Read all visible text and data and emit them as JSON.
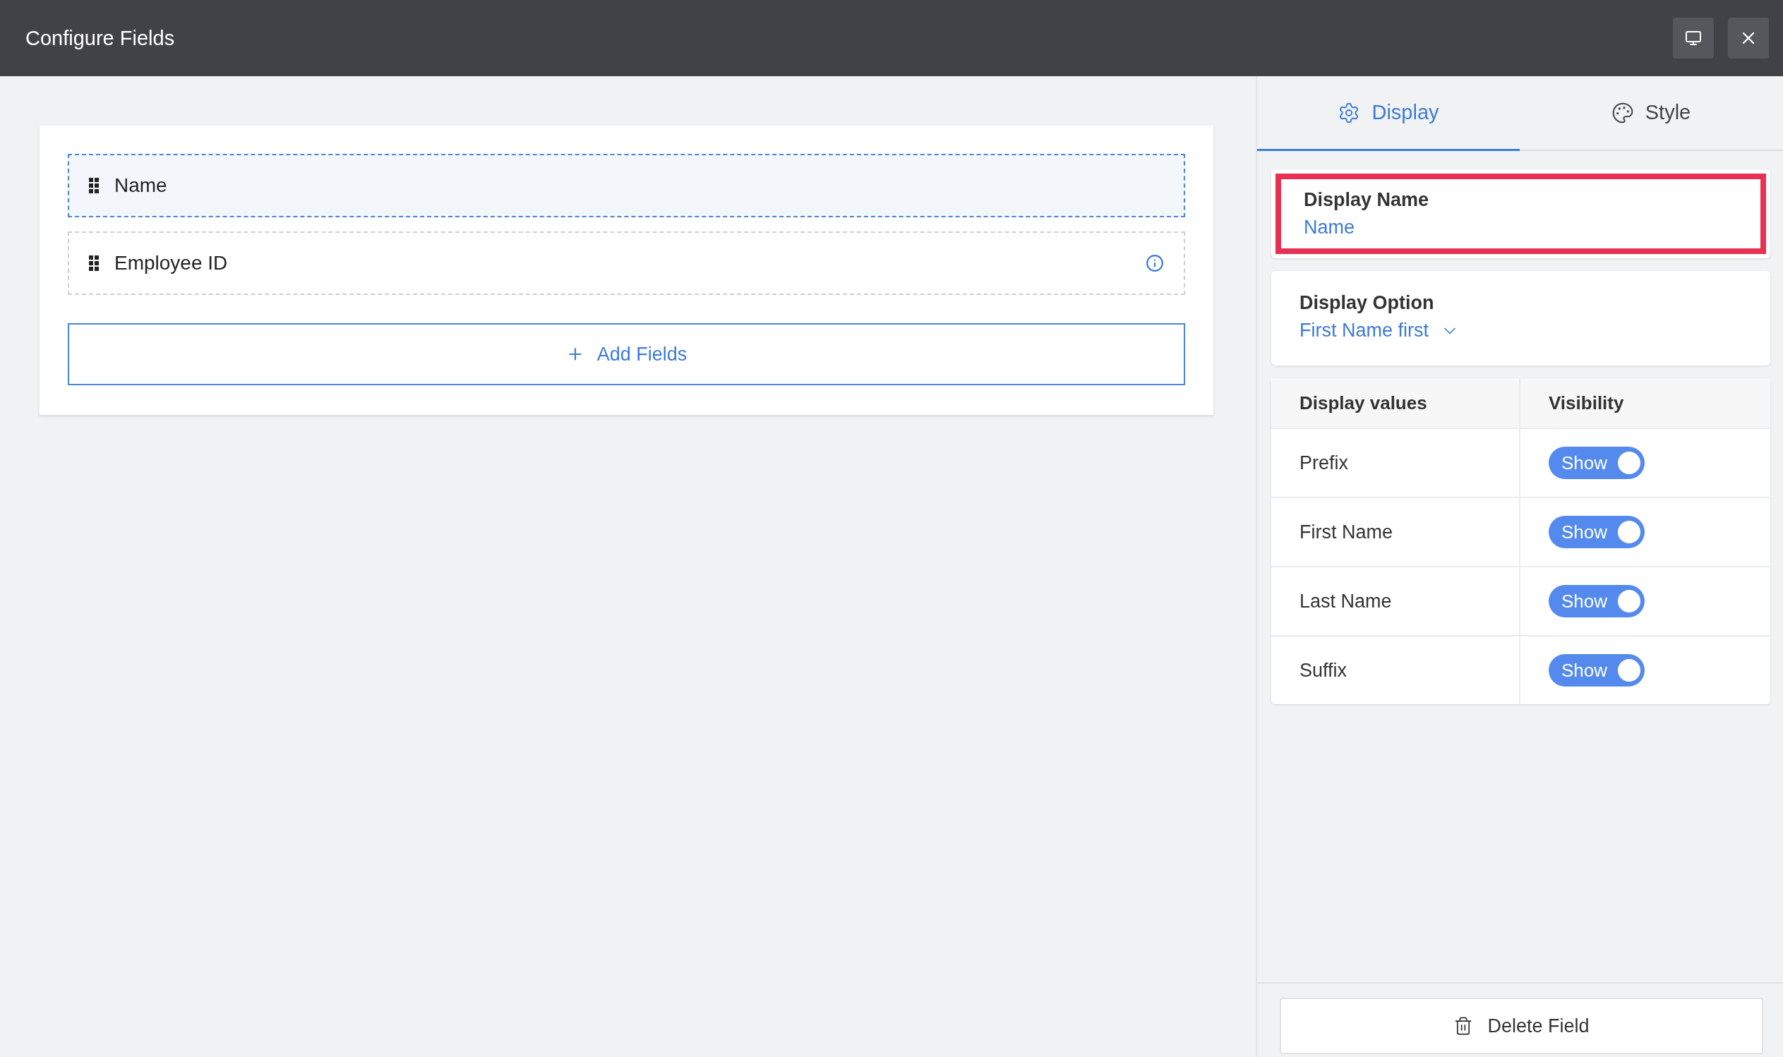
{
  "window": {
    "title": "Configure Fields"
  },
  "fields": [
    {
      "label": "Name",
      "selected": true,
      "info_icon": false
    },
    {
      "label": "Employee ID",
      "selected": false,
      "info_icon": true
    }
  ],
  "add_button": "Add Fields",
  "tabs": [
    {
      "label": "Display",
      "selected": true
    },
    {
      "label": "Style",
      "selected": false
    }
  ],
  "display_name": {
    "label": "Display Name",
    "value": "Name",
    "highlighted": true
  },
  "display_option": {
    "label": "Display Option",
    "value": "First Name first"
  },
  "table": {
    "columns": [
      "Display values",
      "Visibility"
    ],
    "rows": [
      {
        "name": "Prefix",
        "toggle": "Show",
        "on": true
      },
      {
        "name": "First Name",
        "toggle": "Show",
        "on": true
      },
      {
        "name": "Last Name",
        "toggle": "Show",
        "on": true
      },
      {
        "name": "Suffix",
        "toggle": "Show",
        "on": true
      }
    ]
  },
  "delete_button": "Delete Field"
}
